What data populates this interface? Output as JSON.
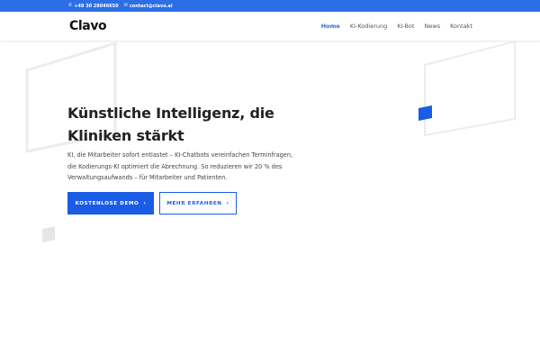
{
  "topbar": {
    "phone": "+49 30 28046650",
    "email": "contact@clavo.ai",
    "phone_icon": "phone-icon",
    "email_icon": "mail-icon",
    "color": "#2d6ee6"
  },
  "header": {
    "logo": "Clavo",
    "nav": [
      {
        "label": "Home",
        "active": true
      },
      {
        "label": "KI-Kodierung",
        "active": false
      },
      {
        "label": "KI-Bot",
        "active": false
      },
      {
        "label": "News",
        "active": false
      },
      {
        "label": "Kontakt",
        "active": false
      }
    ]
  },
  "hero": {
    "title_line1": "Künstliche Intelligenz, die",
    "title_line2": "Kliniken stärkt",
    "description": "KI, die Mitarbeiter sofort entlastet – KI-Chatbots vereinfachen Terminfragen, die Kodierungs-KI optimiert die Abrechnung. So reduzieren wir 20 % des Verwaltungsaufwands – für Mitarbeiter und Patienten.",
    "primary_button": "KOSTENLOSE DEMO",
    "secondary_button": "MEHR ERFAHREN",
    "arrow": "›"
  },
  "colors": {
    "accent": "#1a5ce6",
    "deco_outline": "#e9ecef"
  }
}
